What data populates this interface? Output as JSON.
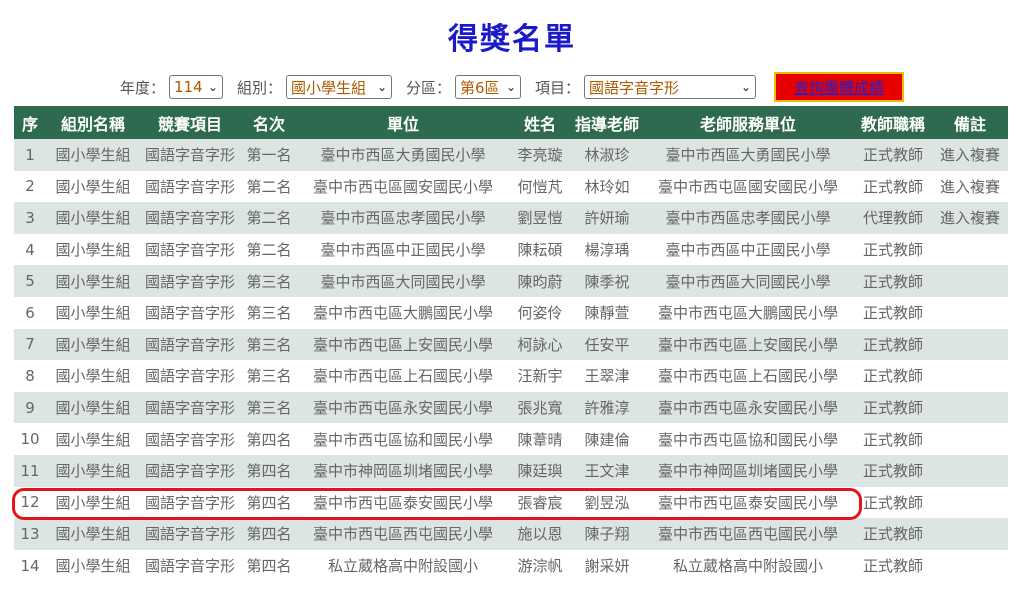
{
  "page": {
    "title": "得獎名單"
  },
  "filters": {
    "year_label": "年度：",
    "year_value": "114",
    "group_label": "組別：",
    "group_value": "國小學生組",
    "district_label": "分區：",
    "district_value": "第6區",
    "item_label": "項目：",
    "item_value": "國語字音字形",
    "query_button": "查詢團體成績"
  },
  "table": {
    "headers": [
      "序",
      "組別名稱",
      "競賽項目",
      "名次",
      "單位",
      "姓名",
      "指導老師",
      "老師服務單位",
      "教師職稱",
      "備註"
    ],
    "rows": [
      [
        "1",
        "國小學生組",
        "國語字音字形",
        "第一名",
        "臺中市西區大勇國民小學",
        "李亮璇",
        "林淑珍",
        "臺中市西區大勇國民小學",
        "正式教師",
        "進入複賽"
      ],
      [
        "2",
        "國小學生組",
        "國語字音字形",
        "第二名",
        "臺中市西屯區國安國民小學",
        "何愷芃",
        "林玲如",
        "臺中市西屯區國安國民小學",
        "正式教師",
        "進入複賽"
      ],
      [
        "3",
        "國小學生組",
        "國語字音字形",
        "第二名",
        "臺中市西區忠孝國民小學",
        "劉昱愷",
        "許妍瑜",
        "臺中市西區忠孝國民小學",
        "代理教師",
        "進入複賽"
      ],
      [
        "4",
        "國小學生組",
        "國語字音字形",
        "第二名",
        "臺中市西區中正國民小學",
        "陳耘碩",
        "楊淳瑀",
        "臺中市西區中正國民小學",
        "正式教師",
        ""
      ],
      [
        "5",
        "國小學生組",
        "國語字音字形",
        "第三名",
        "臺中市西區大同國民小學",
        "陳昀蔚",
        "陳季祝",
        "臺中市西區大同國民小學",
        "正式教師",
        ""
      ],
      [
        "6",
        "國小學生組",
        "國語字音字形",
        "第三名",
        "臺中市西屯區大鵬國民小學",
        "何姿伶",
        "陳靜萱",
        "臺中市西屯區大鵬國民小學",
        "正式教師",
        ""
      ],
      [
        "7",
        "國小學生組",
        "國語字音字形",
        "第三名",
        "臺中市西屯區上安國民小學",
        "柯詠心",
        "任安平",
        "臺中市西屯區上安國民小學",
        "正式教師",
        ""
      ],
      [
        "8",
        "國小學生組",
        "國語字音字形",
        "第三名",
        "臺中市西屯區上石國民小學",
        "汪新宇",
        "王翠津",
        "臺中市西屯區上石國民小學",
        "正式教師",
        ""
      ],
      [
        "9",
        "國小學生組",
        "國語字音字形",
        "第三名",
        "臺中市西屯區永安國民小學",
        "張兆寬",
        "許雅淳",
        "臺中市西屯區永安國民小學",
        "正式教師",
        ""
      ],
      [
        "10",
        "國小學生組",
        "國語字音字形",
        "第四名",
        "臺中市西屯區協和國民小學",
        "陳葦晴",
        "陳建倫",
        "臺中市西屯區協和國民小學",
        "正式教師",
        ""
      ],
      [
        "11",
        "國小學生組",
        "國語字音字形",
        "第四名",
        "臺中市神岡區圳堵國民小學",
        "陳廷璵",
        "王文津",
        "臺中市神岡區圳堵國民小學",
        "正式教師",
        ""
      ],
      [
        "12",
        "國小學生組",
        "國語字音字形",
        "第四名",
        "臺中市西屯區泰安國民小學",
        "張睿宸",
        "劉昱泓",
        "臺中市西屯區泰安國民小學",
        "正式教師",
        ""
      ],
      [
        "13",
        "國小學生組",
        "國語字音字形",
        "第四名",
        "臺中市西屯區西屯國民小學",
        "施以恩",
        "陳子翔",
        "臺中市西屯區西屯國民小學",
        "正式教師",
        ""
      ],
      [
        "14",
        "國小學生組",
        "國語字音字形",
        "第四名",
        "私立葳格高中附設國小",
        "游淙帆",
        "謝采妍",
        "私立葳格高中附設國小",
        "正式教師",
        ""
      ]
    ]
  }
}
